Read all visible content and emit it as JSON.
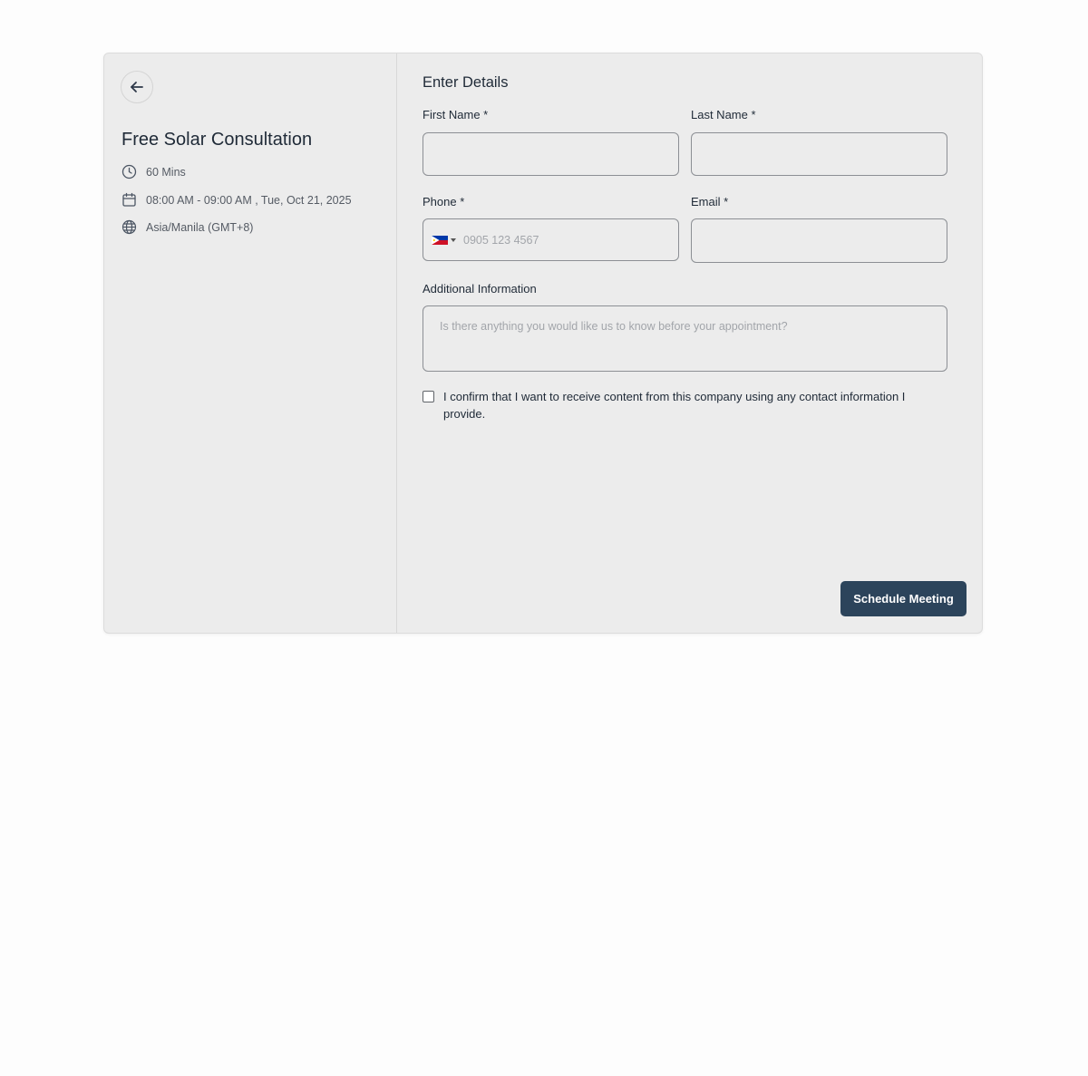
{
  "event": {
    "title": "Free Solar Consultation",
    "duration": "60 Mins",
    "datetime": "08:00 AM - 09:00 AM , Tue, Oct 21, 2025",
    "timezone": "Asia/Manila (GMT+8)"
  },
  "icons": {
    "back": "arrow-left-icon",
    "duration": "clock-icon",
    "date": "calendar-icon",
    "timezone": "globe-icon",
    "country": "philippines-flag-icon",
    "dropdown": "caret-down-icon"
  },
  "form": {
    "title": "Enter Details",
    "first_name_label": "First Name *",
    "first_name_value": "",
    "last_name_label": "Last Name *",
    "last_name_value": "",
    "phone_label": "Phone *",
    "phone_placeholder": "0905 123 4567",
    "phone_value": "",
    "email_label": "Email *",
    "email_value": "",
    "additional_label": "Additional Information",
    "additional_placeholder": "Is there anything you would like us to know before your appointment?",
    "consent_text": "I confirm that I want to receive content from this company using any contact information I provide.",
    "consent_checked": false,
    "submit_label": "Schedule Meeting"
  },
  "colors": {
    "card_background": "#ececec",
    "submit_button": "#2c445b",
    "input_border": "#8c8f94"
  }
}
